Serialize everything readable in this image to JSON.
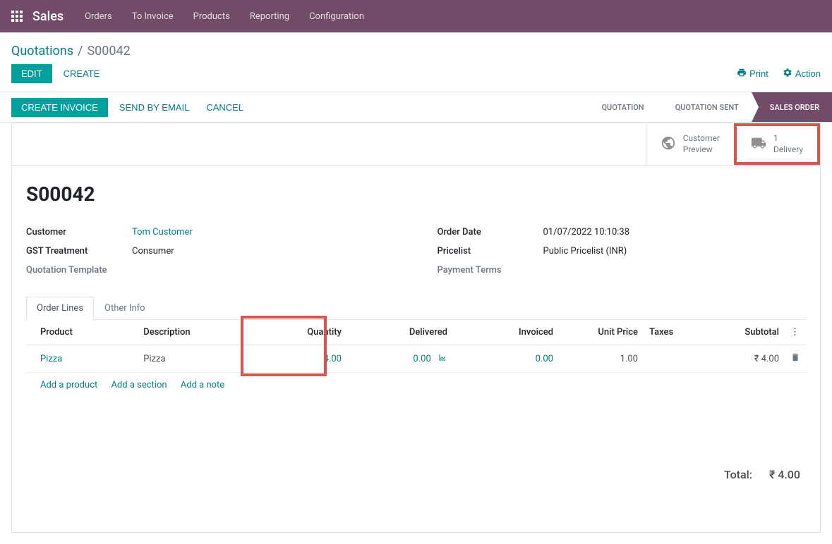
{
  "globalNav": {
    "appName": "Sales",
    "items": [
      "Orders",
      "To Invoice",
      "Products",
      "Reporting",
      "Configuration"
    ]
  },
  "breadcrumb": {
    "parent": "Quotations",
    "current": "S00042"
  },
  "pageActions": {
    "edit": "EDIT",
    "create": "CREATE",
    "print": "Print",
    "action": "Action"
  },
  "statusBar": {
    "buttons": {
      "createInvoice": "CREATE INVOICE",
      "sendEmail": "SEND BY EMAIL",
      "cancel": "CANCEL"
    },
    "steps": [
      "QUOTATION",
      "QUOTATION SENT",
      "SALES ORDER"
    ],
    "activeStepIndex": 2
  },
  "statButtons": {
    "preview": {
      "line1": "Customer",
      "line2": "Preview"
    },
    "delivery": {
      "count": "1",
      "label": "Delivery"
    }
  },
  "order": {
    "name": "S00042",
    "leftFields": {
      "customerLabel": "Customer",
      "customerValue": "Tom Customer",
      "gstLabel": "GST Treatment",
      "gstValue": "Consumer",
      "quoteTplLabel": "Quotation Template",
      "quoteTplValue": ""
    },
    "rightFields": {
      "orderDateLabel": "Order Date",
      "orderDateValue": "01/07/2022 10:10:38",
      "pricelistLabel": "Pricelist",
      "pricelistValue": "Public Pricelist (INR)",
      "paymentTermsLabel": "Payment Terms",
      "paymentTermsValue": ""
    }
  },
  "tabs": {
    "orderLines": "Order Lines",
    "otherInfo": "Other Info"
  },
  "table": {
    "headers": {
      "product": "Product",
      "description": "Description",
      "quantity": "Quantity",
      "delivered": "Delivered",
      "invoiced": "Invoiced",
      "unitPrice": "Unit Price",
      "taxes": "Taxes",
      "subtotal": "Subtotal"
    },
    "rows": [
      {
        "product": "Pizza",
        "description": "Pizza",
        "quantity": "4.00",
        "delivered": "0.00",
        "invoiced": "0.00",
        "unitPrice": "1.00",
        "taxes": "",
        "subtotal": "₹ 4.00"
      }
    ],
    "addLinks": {
      "product": "Add a product",
      "section": "Add a section",
      "note": "Add a note"
    }
  },
  "totals": {
    "label": "Total:",
    "value": "₹ 4.00"
  }
}
